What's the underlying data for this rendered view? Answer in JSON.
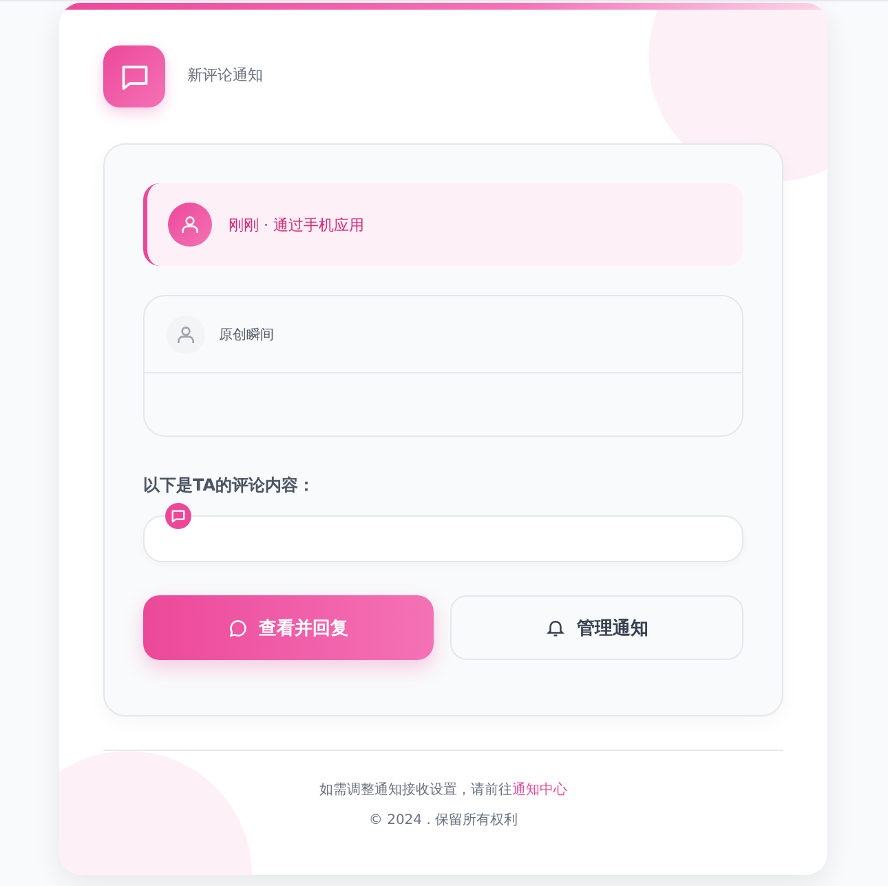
{
  "header": {
    "title": "新评论通知"
  },
  "alert": {
    "text": "刚刚 · 通过手机应用"
  },
  "post": {
    "author": "原创瞬间"
  },
  "comment": {
    "label": "以下是TA的评论内容："
  },
  "buttons": [
    {
      "kind": "primary",
      "label": "查看并回复"
    },
    {
      "kind": "secondary",
      "label": "管理通知"
    }
  ],
  "footer": {
    "note": "如需调整通知接收设置，请前往",
    "link": "通知中心",
    "copyright": "© 2024 . 保留所有权利"
  }
}
